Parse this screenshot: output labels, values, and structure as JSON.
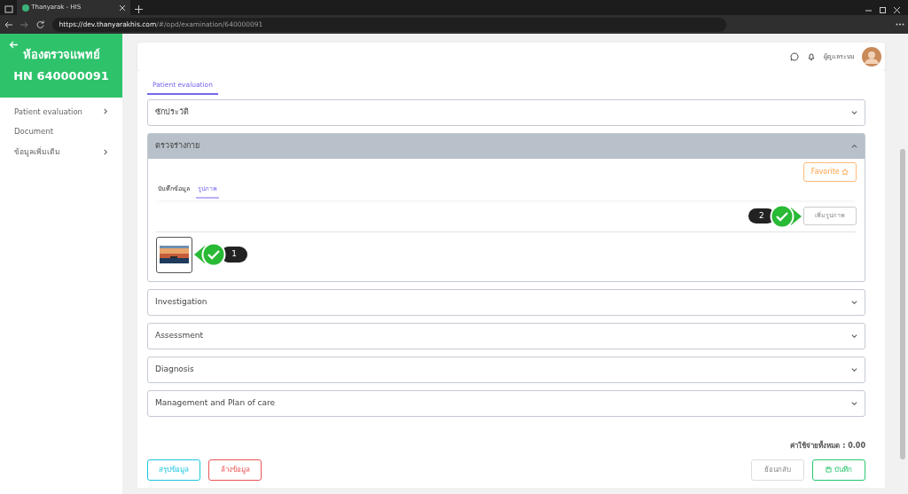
{
  "browser": {
    "tab_title": "Thanyarak - HIS",
    "url_host": "https://dev.thanyarakhis.com",
    "url_path": "/#/opd/examination/640000091"
  },
  "sidebar": {
    "title": "ห้องตรวจแพทย์",
    "hn": "HN 640000091",
    "items": [
      {
        "label": "Patient evaluation",
        "has_children": true
      },
      {
        "label": "Document",
        "has_children": false
      },
      {
        "label": "ข้อมูลเพิ่มเติม",
        "has_children": true
      }
    ]
  },
  "header": {
    "user_name": "ผู้ดูแลระบบ"
  },
  "tabs": [
    {
      "label": "Patient evaluation",
      "selected": true
    }
  ],
  "sections": [
    {
      "title": "ซักประวัติ",
      "expanded": false
    },
    {
      "title": "ตรวจร่างกาย",
      "expanded": true,
      "favorite_button": "Favorite",
      "subtabs": [
        {
          "label": "บันทึกข้อมูล",
          "selected": false
        },
        {
          "label": "รูปภาพ",
          "selected": true
        }
      ],
      "add_image_button": "เพิ่มรูปภาพ",
      "add_image_callout": "2",
      "images": [
        {
          "kind": "picture",
          "callout": "1"
        }
      ]
    },
    {
      "title": "Investigation",
      "expanded": false
    },
    {
      "title": "Assessment",
      "expanded": false
    },
    {
      "title": "Diagnosis",
      "expanded": false
    },
    {
      "title": "Management and Plan of care",
      "expanded": false
    }
  ],
  "footer": {
    "total": "ค่าใช้จ่ายทั้งหมด : 0.00",
    "left_buttons": [
      {
        "label": "สรุปข้อมูล",
        "kind": "info",
        "disabled": false
      },
      {
        "label": "ล้างข้อมูล",
        "kind": "danger",
        "disabled": false
      }
    ],
    "right_buttons": [
      {
        "label": "ย้อนกลับ",
        "kind": "secondary",
        "disabled": true
      },
      {
        "label": "บันทึก",
        "kind": "success",
        "disabled": false
      }
    ]
  }
}
